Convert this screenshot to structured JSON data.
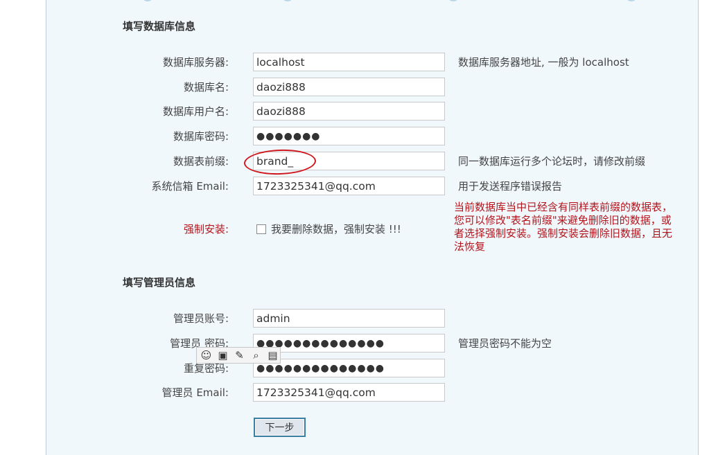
{
  "db_section": {
    "title": "填写数据库信息",
    "server_label": "数据库服务器:",
    "server_value": "localhost",
    "server_hint": "数据库服务器地址, 一般为 localhost",
    "name_label": "数据库名:",
    "name_value": "daozi888",
    "user_label": "数据库用户名:",
    "user_value": "daozi888",
    "pass_label": "数据库密码:",
    "pass_value": "●●●●●●●",
    "prefix_label": "数据表前缀:",
    "prefix_value": "brand_",
    "prefix_hint": "同一数据库运行多个论坛时，请修改前缀",
    "email_label": "系统信箱 Email:",
    "email_value": "1723325341@qq.com",
    "email_hint": "用于发送程序错误报告",
    "force_label": "强制安装:",
    "force_checkbox_label": "我要删除数据，强制安装 !!!",
    "force_warning": "当前数据库当中已经含有同样表前缀的数据表，您可以修改\"表名前缀\"来避免删除旧的数据，或者选择强制安装。强制安装会删除旧数据，且无法恢复"
  },
  "admin_section": {
    "title": "填写管理员信息",
    "account_label": "管理员账号:",
    "account_value": "admin",
    "pass_label": "管理员 密码:",
    "pass_value": "●●●●●●●●●●●●●●",
    "pass_hint": "管理员密码不能为空",
    "repeat_label": "重复密码:",
    "repeat_value": "●●●●●●●●●●●●●●",
    "email_label": "管理员 Email:",
    "email_value": "1723325341@qq.com"
  },
  "submit_label": "下一步",
  "toolbar_icons": [
    "smiley-icon",
    "save-icon",
    "edit-icon",
    "search-icon",
    "image-icon"
  ],
  "colors": {
    "panel_bg": "#f1f8fc",
    "warning_red": "#b3141b",
    "annotation_red": "#d0161c"
  }
}
